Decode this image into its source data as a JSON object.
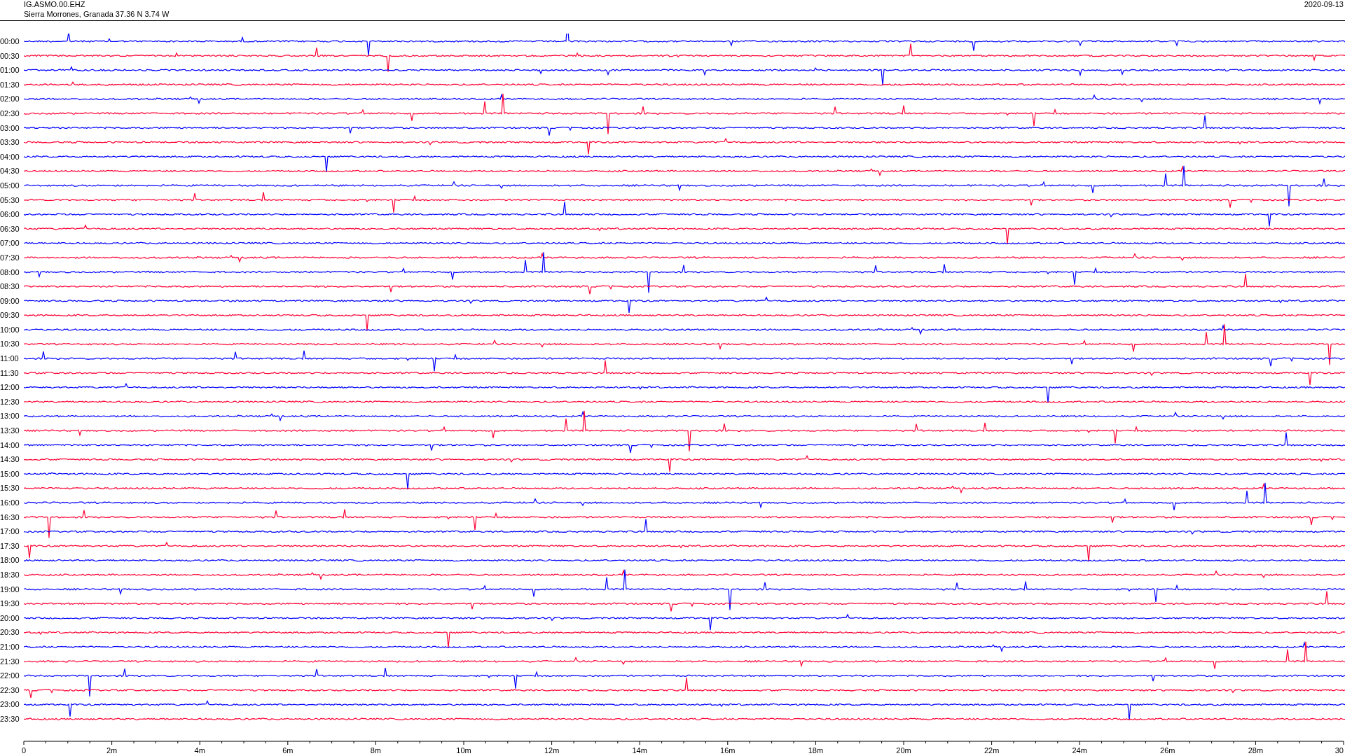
{
  "header": {
    "station": "IG.ASMO.00.EHZ",
    "location": "Sierra Morrones, Granada  37.36 N 3.74 W",
    "date": "2020-09-13"
  },
  "rows": [
    {
      "time": "00:00",
      "color": "#0000ff"
    },
    {
      "time": "00:30",
      "color": "#ff0033"
    },
    {
      "time": "01:00",
      "color": "#0000ff"
    },
    {
      "time": "01:30",
      "color": "#ff0033"
    },
    {
      "time": "02:00",
      "color": "#0000ff"
    },
    {
      "time": "02:30",
      "color": "#ff0033"
    },
    {
      "time": "03:00",
      "color": "#0000ff"
    },
    {
      "time": "03:30",
      "color": "#ff0033"
    },
    {
      "time": "04:00",
      "color": "#0000ff"
    },
    {
      "time": "04:30",
      "color": "#ff0033"
    },
    {
      "time": "05:00",
      "color": "#0000ff"
    },
    {
      "time": "05:30",
      "color": "#ff0033"
    },
    {
      "time": "06:00",
      "color": "#0000ff"
    },
    {
      "time": "06:30",
      "color": "#ff0033"
    },
    {
      "time": "07:00",
      "color": "#0000ff"
    },
    {
      "time": "07:30",
      "color": "#ff0033"
    },
    {
      "time": "08:00",
      "color": "#0000ff"
    },
    {
      "time": "08:30",
      "color": "#ff0033"
    },
    {
      "time": "09:00",
      "color": "#0000ff"
    },
    {
      "time": "09:30",
      "color": "#ff0033"
    },
    {
      "time": "10:00",
      "color": "#0000ff"
    },
    {
      "time": "10:30",
      "color": "#ff0033"
    },
    {
      "time": "11:00",
      "color": "#0000ff"
    },
    {
      "time": "11:30",
      "color": "#ff0033"
    },
    {
      "time": "12:00",
      "color": "#0000ff"
    },
    {
      "time": "12:30",
      "color": "#ff0033"
    },
    {
      "time": "13:00",
      "color": "#0000ff"
    },
    {
      "time": "13:30",
      "color": "#ff0033"
    },
    {
      "time": "14:00",
      "color": "#0000ff"
    },
    {
      "time": "14:30",
      "color": "#ff0033"
    },
    {
      "time": "15:00",
      "color": "#0000ff"
    },
    {
      "time": "15:30",
      "color": "#ff0033"
    },
    {
      "time": "16:00",
      "color": "#0000ff"
    },
    {
      "time": "16:30",
      "color": "#ff0033"
    },
    {
      "time": "17:00",
      "color": "#0000ff"
    },
    {
      "time": "17:30",
      "color": "#ff0033"
    },
    {
      "time": "18:00",
      "color": "#0000ff"
    },
    {
      "time": "18:30",
      "color": "#ff0033"
    },
    {
      "time": "19:00",
      "color": "#0000ff"
    },
    {
      "time": "19:30",
      "color": "#ff0033"
    },
    {
      "time": "20:00",
      "color": "#0000ff"
    },
    {
      "time": "20:30",
      "color": "#ff0033"
    },
    {
      "time": "21:00",
      "color": "#0000ff"
    },
    {
      "time": "21:30",
      "color": "#ff0033"
    },
    {
      "time": "22:00",
      "color": "#0000ff"
    },
    {
      "time": "22:30",
      "color": "#ff0033"
    },
    {
      "time": "23:00",
      "color": "#0000ff"
    },
    {
      "time": "23:30",
      "color": "#ff0033"
    }
  ],
  "x_axis": {
    "ticks": [
      "0",
      "2m",
      "4m",
      "6m",
      "8m",
      "10m",
      "12m",
      "14m",
      "16m",
      "18m",
      "20m",
      "22m",
      "24m",
      "26m",
      "28m",
      "30"
    ]
  }
}
